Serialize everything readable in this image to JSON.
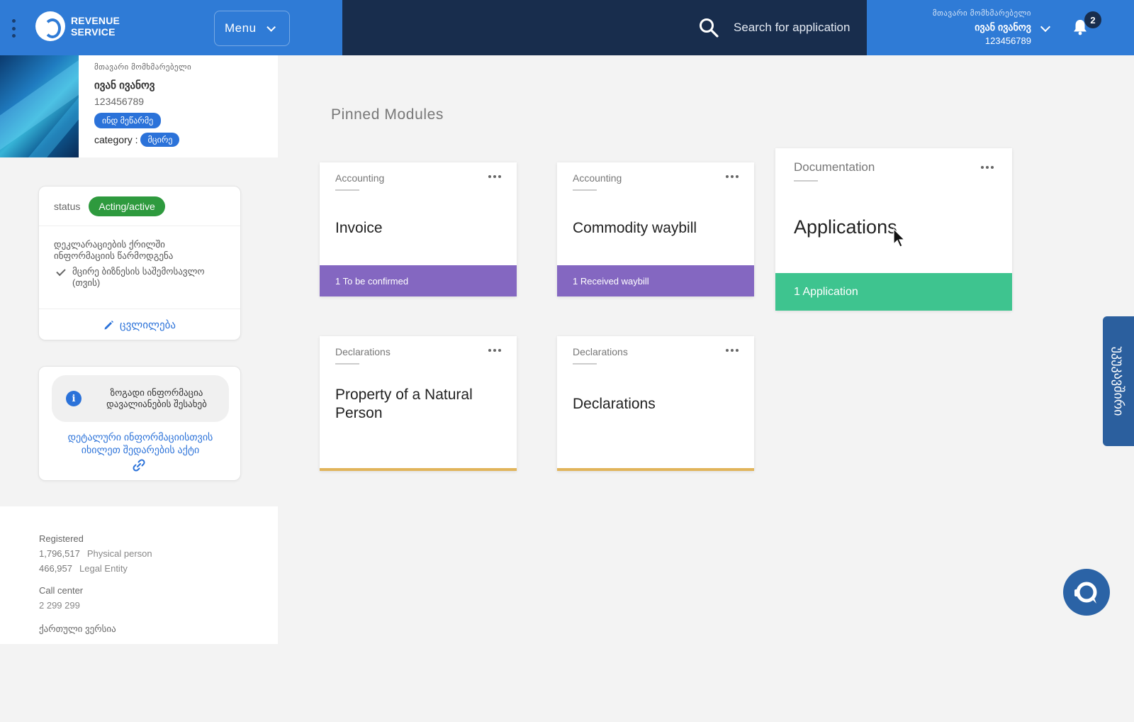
{
  "header": {
    "logo_line1": "REVENUE",
    "logo_line2": "SERVICE",
    "menu_label": "Menu",
    "search_placeholder": "Search for application",
    "user_role": "მთავარი მომხმარებელი",
    "user_name": "ივან ივანოვ",
    "user_id": "123456789",
    "notification_count": "2"
  },
  "profile": {
    "role": "მთავარი მომხმარებელი",
    "name": "ივან ივანოვ",
    "id": "123456789",
    "type_pill": "ინდ მეწარმე",
    "category_label": "category :",
    "category_value": "მცირე"
  },
  "status_card": {
    "label": "status",
    "value": "Acting/active",
    "line1": "დეკლარაციების ქრილში",
    "line2": "ინფორმაციის წარმოდგენა",
    "check_text": "მცირე ბიზნესის საშემოსავლო (თვის)",
    "edit_label": "ცვლილება"
  },
  "info_card": {
    "bubble_text": "ზოგადი ინფორმაცია დავალიანების შესახებ",
    "link_text": "დეტალური ინფორმაციისთვის იხილეთ შედარების აქტი"
  },
  "stats": {
    "registered_label": "Registered",
    "physical_count": "1,796,517",
    "physical_label": "Physical person",
    "legal_count": "466,957",
    "legal_label": "Legal Entity",
    "call_center_label": "Call center",
    "call_center_number": "2 299 299",
    "language_link": "ქართული ვერსია"
  },
  "main": {
    "pinned_title": "Pinned Modules",
    "modules": [
      {
        "category": "Accounting",
        "title": "Invoice",
        "footer": "1 To be confirmed"
      },
      {
        "category": "Accounting",
        "title": "Commodity waybill",
        "footer": "1 Received waybill"
      },
      {
        "category": "Documentation",
        "title": "Applications",
        "footer": "1 Application"
      },
      {
        "category": "Declarations",
        "title": "Property of a Natural Person",
        "footer": ""
      },
      {
        "category": "Declarations",
        "title": "Declarations",
        "footer": ""
      }
    ]
  },
  "feedback_tab": "უკუკავშირი",
  "colors": {
    "header_blue": "#2f7bd6",
    "header_navy": "#182d4d",
    "purple_footer": "#8467c1",
    "green_footer": "#3ec48f",
    "status_green": "#2e9a3e",
    "gold_border": "#e1b45a"
  }
}
